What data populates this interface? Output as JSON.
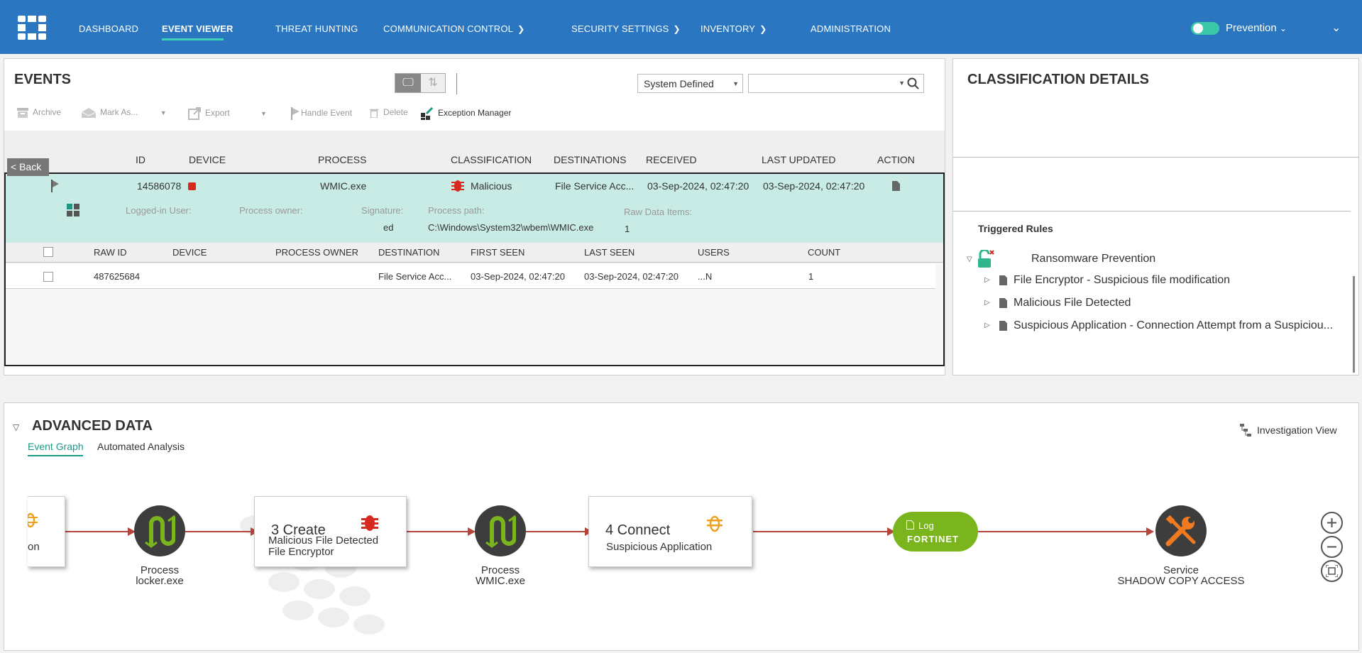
{
  "nav": {
    "items": [
      {
        "label": "DASHBOARD",
        "has_menu": false
      },
      {
        "label": "EVENT VIEWER",
        "has_menu": false,
        "active": true
      },
      {
        "label": "THREAT HUNTING",
        "has_menu": false
      },
      {
        "label": "COMMUNICATION CONTROL",
        "has_menu": true
      },
      {
        "label": "SECURITY SETTINGS",
        "has_menu": true
      },
      {
        "label": "INVENTORY",
        "has_menu": true
      },
      {
        "label": "ADMINISTRATION",
        "has_menu": false
      }
    ],
    "mode_label": "Prevention",
    "mode_on": true,
    "accent": "#3fd1b6",
    "bar_color": "#2b76c0"
  },
  "events": {
    "title": "EVENTS",
    "filter_value": "System Defined",
    "search_value": "",
    "toolbar": {
      "archive": "Archive",
      "mark_as": "Mark As...",
      "export": "Export",
      "handle_event": "Handle Event",
      "delete": "Delete",
      "exception_manager": "Exception Manager"
    },
    "back_label": "< Back",
    "columns": [
      "ID",
      "DEVICE",
      "PROCESS",
      "CLASSIFICATION",
      "DESTINATIONS",
      "RECEIVED",
      "LAST UPDATED",
      "ACTION"
    ],
    "row": {
      "id": "14586078",
      "process": "WMIC.exe",
      "classification": "Malicious",
      "destinations": "File Service Acc...",
      "received": "03-Sep-2024, 02:47:20",
      "last_updated": "03-Sep-2024, 02:47:20"
    },
    "details": {
      "logged_in_user_label": "Logged-in User:",
      "process_owner_label": "Process owner:",
      "signature_label": "Signature:",
      "signature_value": "ed",
      "process_path_label": "Process path:",
      "process_path_value": "C:\\Windows\\System32\\wbem\\WMIC.exe",
      "raw_items_label": "Raw Data Items:",
      "raw_items_value": "1"
    },
    "raw_columns": [
      "RAW ID",
      "DEVICE",
      "PROCESS OWNER",
      "DESTINATION",
      "FIRST SEEN",
      "LAST SEEN",
      "USERS",
      "COUNT"
    ],
    "raw_row": {
      "raw_id": "487625684",
      "destination": "File Service Acc...",
      "first_seen": "03-Sep-2024, 02:47:20",
      "last_seen": "03-Sep-2024, 02:47:20",
      "users": "...N",
      "count": "1"
    }
  },
  "classification": {
    "title": "CLASSIFICATION DETAILS",
    "triggered_title": "Triggered Rules",
    "policy": "Ransomware Prevention",
    "rules": [
      "File Encryptor - Suspicious file modification",
      "Malicious File Detected",
      "Suspicious Application - Connection Attempt from a Suspiciou..."
    ]
  },
  "advanced": {
    "title": "ADVANCED DATA",
    "tabs": [
      "Event Graph",
      "Automated Analysis"
    ],
    "active_tab": "Event Graph",
    "investigation_view": "Investigation View",
    "graph": {
      "partial_node_label": "on",
      "node1": {
        "type": "Process",
        "name": "locker.exe"
      },
      "card1": {
        "title": "3 Create",
        "line1": "Malicious File Detected",
        "line2": "File Encryptor"
      },
      "node2": {
        "type": "Process",
        "name": "WMIC.exe"
      },
      "card2": {
        "title": "4 Connect",
        "line1": "Suspicious Application"
      },
      "log": {
        "label": "Log",
        "brand": "FORTINET"
      },
      "service": {
        "type": "Service",
        "name": "SHADOW COPY ACCESS"
      }
    }
  },
  "colors": {
    "malicious": "#d62a20",
    "suspicious": "#f0a020",
    "teal_row": "#c8ece5",
    "log_green": "#7ab51d",
    "edge": "#b5443a"
  }
}
